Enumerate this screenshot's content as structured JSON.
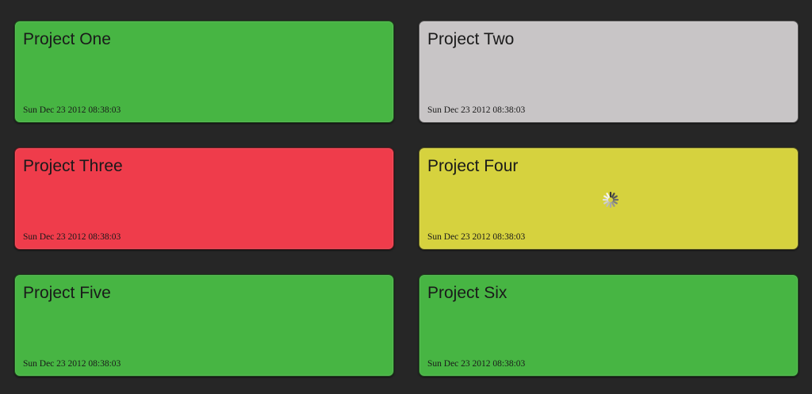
{
  "projects": [
    {
      "name": "Project One",
      "timestamp": "Sun Dec 23 2012 08:38:03",
      "status": "success",
      "color": "#47b543"
    },
    {
      "name": "Project Two",
      "timestamp": "Sun Dec 23 2012 08:38:03",
      "status": "inactive",
      "color": "#c8c5c6"
    },
    {
      "name": "Project Three",
      "timestamp": "Sun Dec 23 2012 08:38:03",
      "status": "failure",
      "color": "#ef3c4b"
    },
    {
      "name": "Project Four",
      "timestamp": "Sun Dec 23 2012 08:38:03",
      "status": "building",
      "color": "#d6d23e",
      "loading_icon": "spinner-icon"
    },
    {
      "name": "Project Five",
      "timestamp": "Sun Dec 23 2012 08:38:03",
      "status": "success",
      "color": "#47b543"
    },
    {
      "name": "Project Six",
      "timestamp": "Sun Dec 23 2012 08:38:03",
      "status": "success",
      "color": "#47b543"
    }
  ],
  "colors": {
    "background": "#262626",
    "text": "#1a1a1a"
  }
}
